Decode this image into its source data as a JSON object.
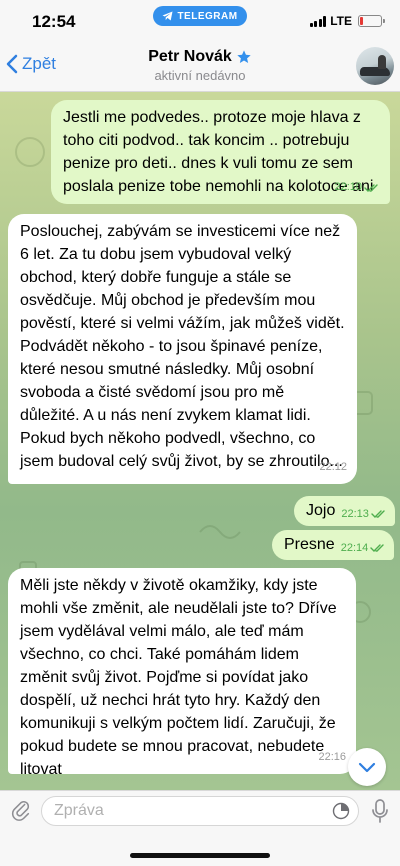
{
  "status_bar": {
    "time": "12:54",
    "app_pill": "TELEGRAM",
    "network": "LTE",
    "battery_color": "#e53935"
  },
  "header": {
    "back_label": "Zpět",
    "contact_name": "Petr Novák",
    "contact_status": "aktivní nedávno",
    "verified_icon": "star-icon"
  },
  "messages": [
    {
      "direction": "out",
      "text": "Jestli me podvedes.. protoze moje hlava z toho citi podvod.. tak koncim .. potrebuju penize pro deti.. dnes k vuli tomu ze sem poslala penize tobe nemohli na kolotoce ani",
      "time": "22:10",
      "read": true
    },
    {
      "direction": "in",
      "text": "Poslouchej, zabývám se investicemi více než 6 let. Za tu dobu jsem vybudoval velký obchod, který dobře funguje a stále se osvědčuje. Můj obchod je především mou pověstí, které si velmi vážím, jak můžeš vidět. Podvádět někoho - to jsou špinavé peníze, které nesou smutné následky. Můj osobní svoboda a čisté svědomí jsou pro mě důležité. A u nás není zvykem klamat lidi. Pokud bych někoho podvedl, všechno, co jsem budoval celý svůj život, by se zhroutilo...",
      "time": "22:12"
    },
    {
      "direction": "out",
      "text": "Jojo",
      "time": "22:13",
      "read": true
    },
    {
      "direction": "out",
      "text": "Presne",
      "time": "22:14",
      "read": true
    },
    {
      "direction": "in",
      "text": "Měli jste někdy v životě okamžiky, kdy jste mohli vše změnit, ale neudělali jste to? Dříve jsem vydělával velmi málo, ale teď mám všechno, co chci. Také pomáhám lidem změnit svůj život. Pojďme si povídat jako dospělí, už nechci hrát tyto hry. Každý den komunikuji s velkým počtem lidí. Zaručuji, že pokud budete se mnou pracovat, nebudete litovat",
      "time": "22:16"
    }
  ],
  "input": {
    "placeholder": "Zpráva"
  },
  "colors": {
    "accent": "#2f7fe0",
    "outgoing_bubble": "#e2f8c8",
    "incoming_bubble": "#ffffff",
    "read_check": "#4fae4e"
  }
}
